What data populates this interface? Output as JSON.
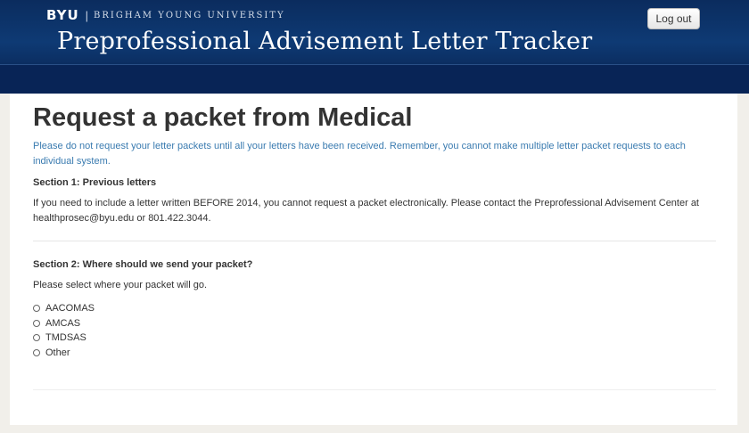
{
  "header": {
    "byu_logo": "BYU",
    "separator": "|",
    "university": "BRIGHAM YOUNG UNIVERSITY",
    "app_title": "Preprofessional Advisement Letter Tracker",
    "logout_label": "Log out"
  },
  "main": {
    "title": "Request a packet from Medical",
    "notice": "Please do not request your letter packets until all your letters have been received. Remember, you cannot make multiple letter packet requests to each individual system.",
    "section1": {
      "heading": "Section 1: Previous letters",
      "text": "If you need to include a letter written BEFORE 2014, you cannot request a packet electronically. Please contact the Preprofessional Advisement Center at healthprosec@byu.edu or 801.422.3044."
    },
    "section2": {
      "heading": "Section 2: Where should we send your packet?",
      "prompt": "Please select where your packet will go.",
      "options": [
        "AACOMAS",
        "AMCAS",
        "TMDSAS",
        "Other"
      ]
    }
  }
}
